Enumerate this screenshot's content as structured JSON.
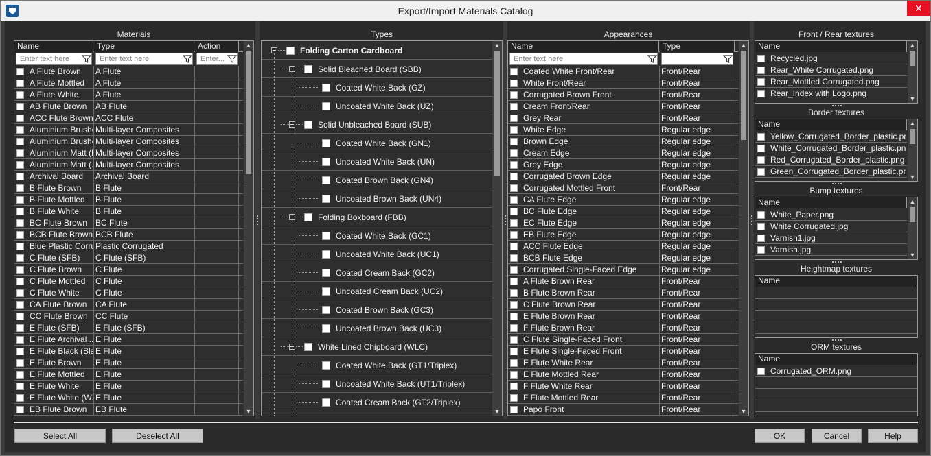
{
  "window": {
    "title": "Export/Import Materials Catalog",
    "close_glyph": "✕"
  },
  "materials": {
    "title": "Materials",
    "columns": [
      "Name",
      "Type",
      "Action"
    ],
    "filter_placeholders": [
      "Enter text here",
      "Enter text here",
      "Enter..."
    ],
    "rows": [
      [
        "A Flute Brown",
        "A Flute"
      ],
      [
        "A Flute Mottled",
        "A Flute"
      ],
      [
        "A Flute White",
        "A Flute"
      ],
      [
        "AB Flute Brown",
        "AB Flute"
      ],
      [
        "ACC Flute Brown",
        "ACC Flute"
      ],
      [
        "Aluminium Brushe...",
        "Multi-layer Composites"
      ],
      [
        "Aluminium Brushe...",
        "Multi-layer Composites"
      ],
      [
        "Aluminium Matt (B...",
        "Multi-layer Composites"
      ],
      [
        "Aluminium Matt (...",
        "Multi-layer Composites"
      ],
      [
        "Archival Board",
        "Archival Board"
      ],
      [
        "B Flute Brown",
        "B Flute"
      ],
      [
        "B Flute Mottled",
        "B Flute"
      ],
      [
        "B Flute White",
        "B Flute"
      ],
      [
        "BC Flute Brown",
        "BC Flute"
      ],
      [
        "BCB Flute Brown",
        "BCB Flute"
      ],
      [
        "Blue Plastic Corru...",
        "Plastic Corrugated"
      ],
      [
        "C Flute (SFB)",
        "C Flute (SFB)"
      ],
      [
        "C Flute Brown",
        "C Flute"
      ],
      [
        "C Flute Mottled",
        "C Flute"
      ],
      [
        "C Flute White",
        "C Flute"
      ],
      [
        "CA Flute Brown",
        "CA Flute"
      ],
      [
        "CC Flute Brown",
        "CC Flute"
      ],
      [
        "E Flute (SFB)",
        "E Flute (SFB)"
      ],
      [
        "E Flute Archival ...",
        "E Flute"
      ],
      [
        "E Flute Black (Bla...",
        "E Flute"
      ],
      [
        "E Flute Brown",
        "E Flute"
      ],
      [
        "E Flute Mottled",
        "E Flute"
      ],
      [
        "E Flute White",
        "E Flute"
      ],
      [
        "E Flute White (W...",
        "E Flute"
      ],
      [
        "EB Flute Brown",
        "EB Flute"
      ]
    ]
  },
  "types": {
    "title": "Types",
    "nodes": [
      {
        "label": "Folding Carton Cardboard",
        "level": 0,
        "bold": true
      },
      {
        "label": "Solid Bleached Board (SBB)",
        "level": 1
      },
      {
        "label": "Coated White Back (GZ)",
        "level": 2
      },
      {
        "label": "Uncoated White Back (UZ)",
        "level": 2
      },
      {
        "label": "Solid Unbleached Board (SUB)",
        "level": 1
      },
      {
        "label": "Coated White Back (GN1)",
        "level": 2
      },
      {
        "label": "Uncoated White Back (UN)",
        "level": 2
      },
      {
        "label": "Coated Brown Back (GN4)",
        "level": 2
      },
      {
        "label": "Uncoated Brown Back (UN4)",
        "level": 2
      },
      {
        "label": "Folding Boxboard (FBB)",
        "level": 1
      },
      {
        "label": "Coated White Back (GC1)",
        "level": 2
      },
      {
        "label": "Uncoated White Back (UC1)",
        "level": 2
      },
      {
        "label": "Coated Cream Back (GC2)",
        "level": 2
      },
      {
        "label": "Uncoated Cream Back (UC2)",
        "level": 2
      },
      {
        "label": "Coated Brown Back (GC3)",
        "level": 2
      },
      {
        "label": "Uncoated Brown Back (UC3)",
        "level": 2
      },
      {
        "label": "White Lined Chipboard (WLC)",
        "level": 1
      },
      {
        "label": "Coated White Back (GT1/Triplex)",
        "level": 2
      },
      {
        "label": "Uncoated White Back (UT1/Triplex)",
        "level": 2
      },
      {
        "label": "Coated Cream Back (GT2/Triplex)",
        "level": 2
      }
    ]
  },
  "appearances": {
    "title": "Appearances",
    "columns": [
      "Name",
      "Type"
    ],
    "filter_placeholders": [
      "Enter text here",
      ""
    ],
    "rows": [
      [
        "Coated White Front/Rear",
        "Front/Rear"
      ],
      [
        "White Front/Rear",
        "Front/Rear"
      ],
      [
        "Corrugated Brown Front",
        "Front/Rear"
      ],
      [
        "Cream Front/Rear",
        "Front/Rear"
      ],
      [
        "Grey Rear",
        "Front/Rear"
      ],
      [
        "White Edge",
        "Regular edge"
      ],
      [
        "Brown Edge",
        "Regular edge"
      ],
      [
        "Cream Edge",
        "Regular edge"
      ],
      [
        "Grey Edge",
        "Regular edge"
      ],
      [
        "Corrugated Brown Edge",
        "Regular edge"
      ],
      [
        "Corrugated Mottled Front",
        "Front/Rear"
      ],
      [
        "CA Flute Edge",
        "Regular edge"
      ],
      [
        "BC Flute Edge",
        "Regular edge"
      ],
      [
        "EC Flute Edge",
        "Regular edge"
      ],
      [
        "EB Flute Edge",
        "Regular edge"
      ],
      [
        "ACC Flute Edge",
        "Regular edge"
      ],
      [
        "BCB Flute Edge",
        "Regular edge"
      ],
      [
        "Corrugated Single-Faced Edge",
        "Regular edge"
      ],
      [
        "A Flute Brown Rear",
        "Front/Rear"
      ],
      [
        "B Flute Brown Rear",
        "Front/Rear"
      ],
      [
        "C Flute Brown Rear",
        "Front/Rear"
      ],
      [
        "E Flute Brown Rear",
        "Front/Rear"
      ],
      [
        "F Flute Brown Rear",
        "Front/Rear"
      ],
      [
        "C Flute Single-Faced Front",
        "Front/Rear"
      ],
      [
        "E Flute Single-Faced Front",
        "Front/Rear"
      ],
      [
        "E Flute White Rear",
        "Front/Rear"
      ],
      [
        "E Flute Mottled Rear",
        "Front/Rear"
      ],
      [
        "F Flute White Rear",
        "Front/Rear"
      ],
      [
        "F Flute Mottled Rear",
        "Front/Rear"
      ],
      [
        "Papo Front",
        "Front/Rear"
      ]
    ]
  },
  "textures": [
    {
      "title": "Front / Rear textures",
      "column": "Name",
      "items": [
        "Recycled.jpg",
        "Rear_White Corrugated.png",
        "Rear_Mottled Corrugated.png",
        "Rear_Index with Logo.png"
      ]
    },
    {
      "title": "Border textures",
      "column": "Name",
      "items": [
        "Yellow_Corrugated_Border_plastic.png",
        "White_Corrugated_Border_plastic.png",
        "Red_Corrugated_Border_plastic.png",
        "Green_Corrugated_Border_plastic.png"
      ]
    },
    {
      "title": "Bump textures",
      "column": "Name",
      "items": [
        "White_Paper.png",
        "White Corrugated.jpg",
        "Varnish1.jpg",
        "Varnish.jpg"
      ]
    },
    {
      "title": "Heightmap textures",
      "column": "Name",
      "items": []
    },
    {
      "title": "ORM textures",
      "column": "Name",
      "items": [
        "Corrugated_ORM.png"
      ]
    }
  ],
  "buttons": {
    "select_all": "Select All",
    "deselect_all": "Deselect All",
    "ok": "OK",
    "cancel": "Cancel",
    "help": "Help"
  },
  "colors": {
    "background": "#2a2a2a",
    "button": "#c7c7c7",
    "close": "#e81123"
  }
}
